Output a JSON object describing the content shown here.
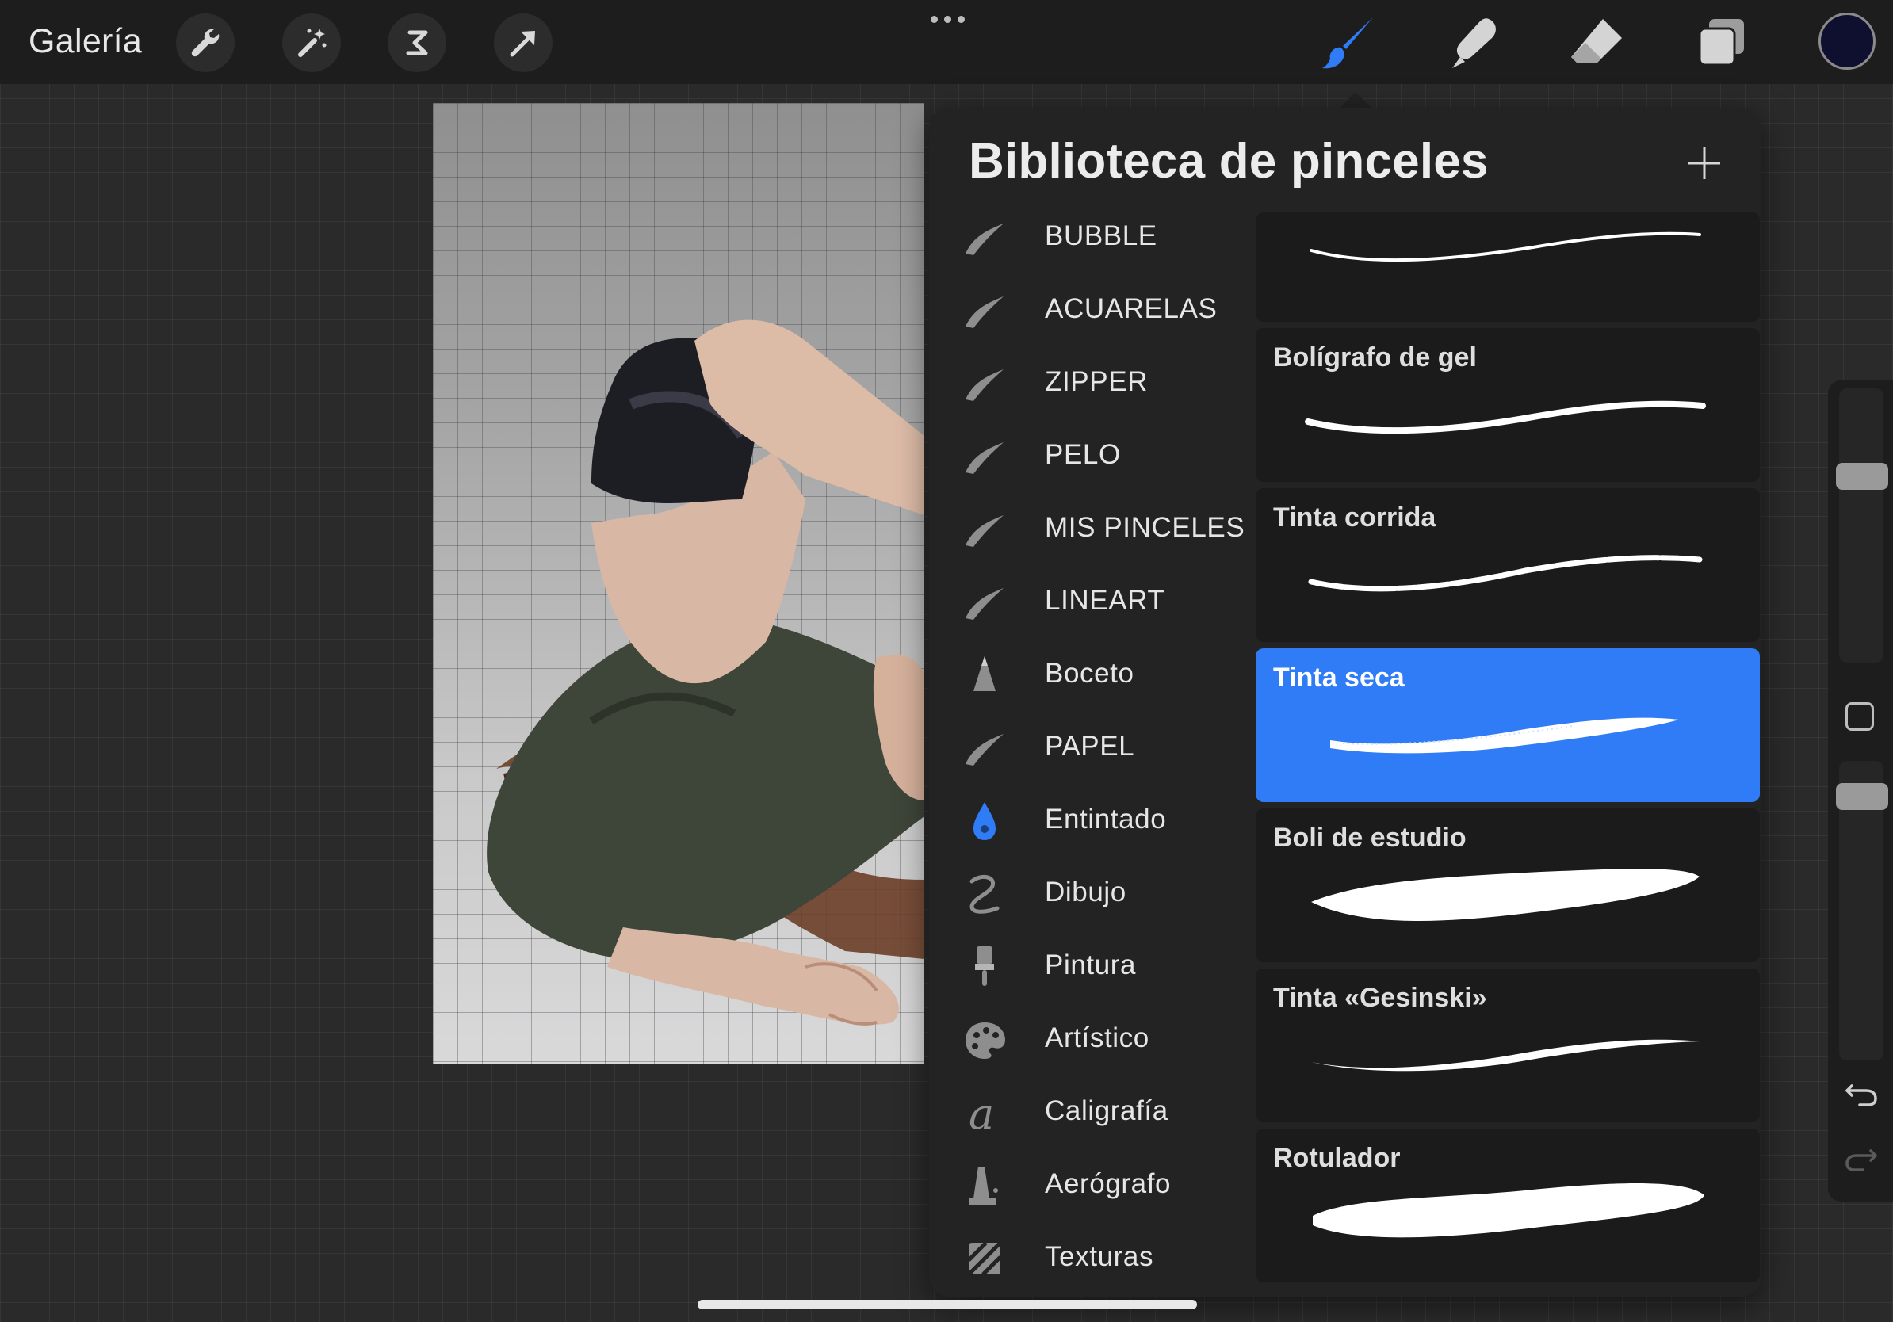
{
  "topbar": {
    "gallery_label": "Galería",
    "left_tools": [
      "wrench-icon",
      "magic-wand-icon",
      "selection-icon",
      "transform-arrow-icon"
    ],
    "right_tools": [
      "brush-icon",
      "smudge-icon",
      "eraser-icon",
      "layers-icon"
    ],
    "active_tool": "brush-icon",
    "current_color": "#0f1030"
  },
  "panel": {
    "title": "Biblioteca de pinceles",
    "brush_sets": [
      {
        "label": "BUBBLE",
        "icon": "stroke-icon"
      },
      {
        "label": "ACUARELAS",
        "icon": "stroke-icon"
      },
      {
        "label": "ZIPPER",
        "icon": "stroke-icon"
      },
      {
        "label": "PELO",
        "icon": "stroke-icon"
      },
      {
        "label": "MIS PINCELES",
        "icon": "stroke-icon"
      },
      {
        "label": "LINEART",
        "icon": "stroke-icon"
      },
      {
        "label": "Boceto",
        "icon": "pencil-tip-icon"
      },
      {
        "label": "PAPEL",
        "icon": "stroke-icon"
      },
      {
        "label": "Entintado",
        "icon": "ink-drop-icon"
      },
      {
        "label": "Dibujo",
        "icon": "squiggle-icon"
      },
      {
        "label": "Pintura",
        "icon": "paint-brush-icon"
      },
      {
        "label": "Artístico",
        "icon": "palette-icon"
      },
      {
        "label": "Caligrafía",
        "icon": "calligraphy-icon"
      },
      {
        "label": "Aerógrafo",
        "icon": "airbrush-icon"
      },
      {
        "label": "Texturas",
        "icon": "texture-icon"
      }
    ],
    "active_set": "Entintado",
    "brushes": [
      {
        "name": ""
      },
      {
        "name": "Bolígrafo de gel"
      },
      {
        "name": "Tinta corrida"
      },
      {
        "name": "Tinta seca",
        "selected": true
      },
      {
        "name": "Boli de estudio"
      },
      {
        "name": "Tinta «Gesinski»"
      },
      {
        "name": "Rotulador"
      }
    ],
    "selected_color": "#2f7cf6"
  },
  "sidebar": {
    "brush_size_level": 0.3,
    "opacity_level": 0.08
  }
}
